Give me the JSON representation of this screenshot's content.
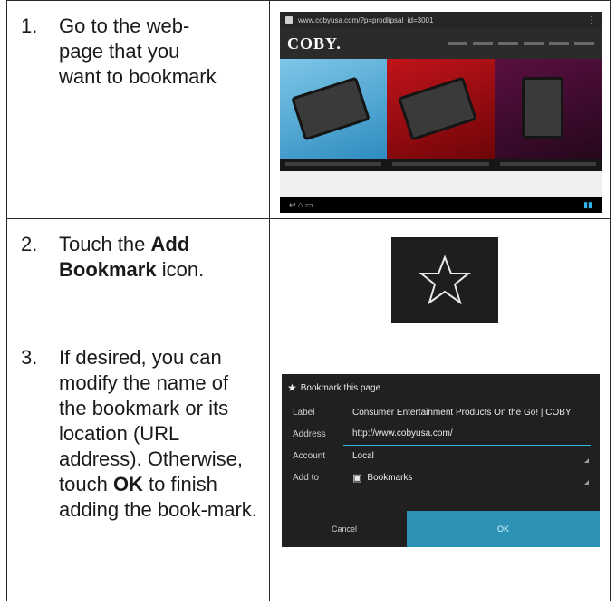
{
  "steps": [
    {
      "number": "1.",
      "lines": [
        "Go to the web-",
        "page that you",
        "want to bookmark"
      ],
      "screenshot": {
        "url": "www.cobyusa.com/?p=prodlipsal_id=3001",
        "logo": "COBY.",
        "menu_icon": "overflow-menu-icon"
      }
    },
    {
      "number": "2.",
      "pre": "Touch the ",
      "bold": "Add Bookmark",
      "post": " icon.",
      "icon": "star-outline-icon"
    },
    {
      "number": "3.",
      "text_a": "If desired, you can modify the name of the bookmark or its location (URL address). Otherwise, touch ",
      "bold": "OK",
      "text_b": " to finish adding the book-mark.",
      "dialog": {
        "title": "Bookmark this page",
        "label_caption": "Label",
        "label_value": "Consumer Entertainment Products On the Go! | COBY",
        "address_caption": "Address",
        "address_value": "http://www.cobyusa.com/",
        "account_caption": "Account",
        "account_value": "Local",
        "addto_caption": "Add to",
        "addto_value": "Bookmarks",
        "cancel_label": "Cancel",
        "ok_label": "OK"
      }
    }
  ],
  "colors": {
    "accent": "#33b5e5",
    "ok_button": "#2d93b6"
  }
}
